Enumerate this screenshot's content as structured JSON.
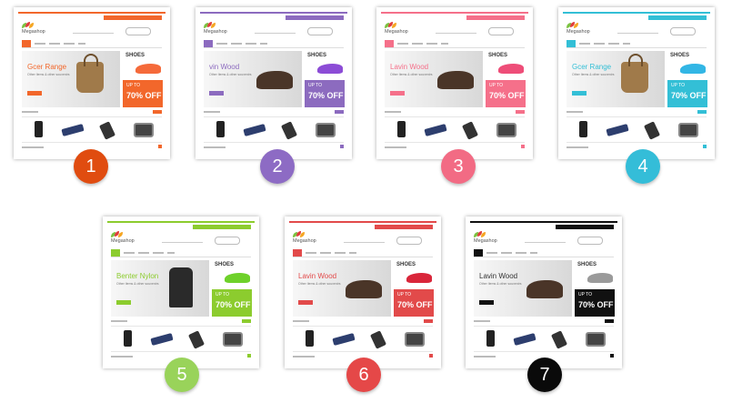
{
  "themes": [
    {
      "number": "1",
      "accent": "#f2672b",
      "badge": "#e04c10",
      "brand": "Megashop",
      "hero_title": "Gcer Range",
      "hero_sub": "Other Items & other souvenirs",
      "promo_top": "SHOES",
      "promo_up": "UP TO",
      "promo_pct": "70% OFF",
      "hero_item": "bag-icon",
      "shoe": "#f56a3a"
    },
    {
      "number": "2",
      "accent": "#8c6bbf",
      "badge": "#8d6bc4",
      "brand": "Megashop",
      "hero_title": "vin Wood",
      "hero_sub": "Other Items & other souvenirs",
      "promo_top": "SHOES",
      "promo_up": "UP TO",
      "promo_pct": "70% OFF",
      "hero_item": "shoe-icon",
      "shoe": "#8c4cd6"
    },
    {
      "number": "3",
      "accent": "#f5708a",
      "badge": "#f26b84",
      "brand": "Megashop",
      "hero_title": "Lavin Wood",
      "hero_sub": "Other Items & other souvenirs",
      "promo_top": "SHOES",
      "promo_up": "UP TO",
      "promo_pct": "70% OFF",
      "hero_item": "shoe-icon",
      "shoe": "#ee4d78"
    },
    {
      "number": "4",
      "accent": "#33bfd6",
      "badge": "#34bdd8",
      "brand": "Megashop",
      "hero_title": "Gcer Range",
      "hero_sub": "Other Items & other souvenirs",
      "promo_top": "SHOES",
      "promo_up": "UP TO",
      "promo_pct": "70% OFF",
      "hero_item": "bag-icon",
      "shoe": "#32b6e5"
    },
    {
      "number": "5",
      "accent": "#8ccc2e",
      "badge": "#99d35a",
      "brand": "Megashop",
      "hero_title": "Benter Nylon",
      "hero_sub": "Other Items & other souvenirs",
      "promo_top": "SHOES",
      "promo_up": "UP TO",
      "promo_pct": "70% OFF",
      "hero_item": "jacket-icon",
      "shoe": "#6ed12a"
    },
    {
      "number": "6",
      "accent": "#e24a4a",
      "badge": "#e54848",
      "brand": "Megashop",
      "hero_title": "Lavin Wood",
      "hero_sub": "Other Items & other souvenirs",
      "promo_top": "SHOES",
      "promo_up": "UP TO",
      "promo_pct": "70% OFF",
      "hero_item": "shoe-icon",
      "shoe": "#d9263a"
    },
    {
      "number": "7",
      "accent": "#111111",
      "badge": "#0a0a0a",
      "brand": "Megashop",
      "hero_title": "Lavin Wood",
      "hero_sub": "Other Items & other souvenirs",
      "promo_top": "SHOES",
      "promo_up": "UP TO",
      "promo_pct": "70% OFF",
      "hero_item": "shoe-icon",
      "shoe": "#9a9a9a"
    }
  ]
}
